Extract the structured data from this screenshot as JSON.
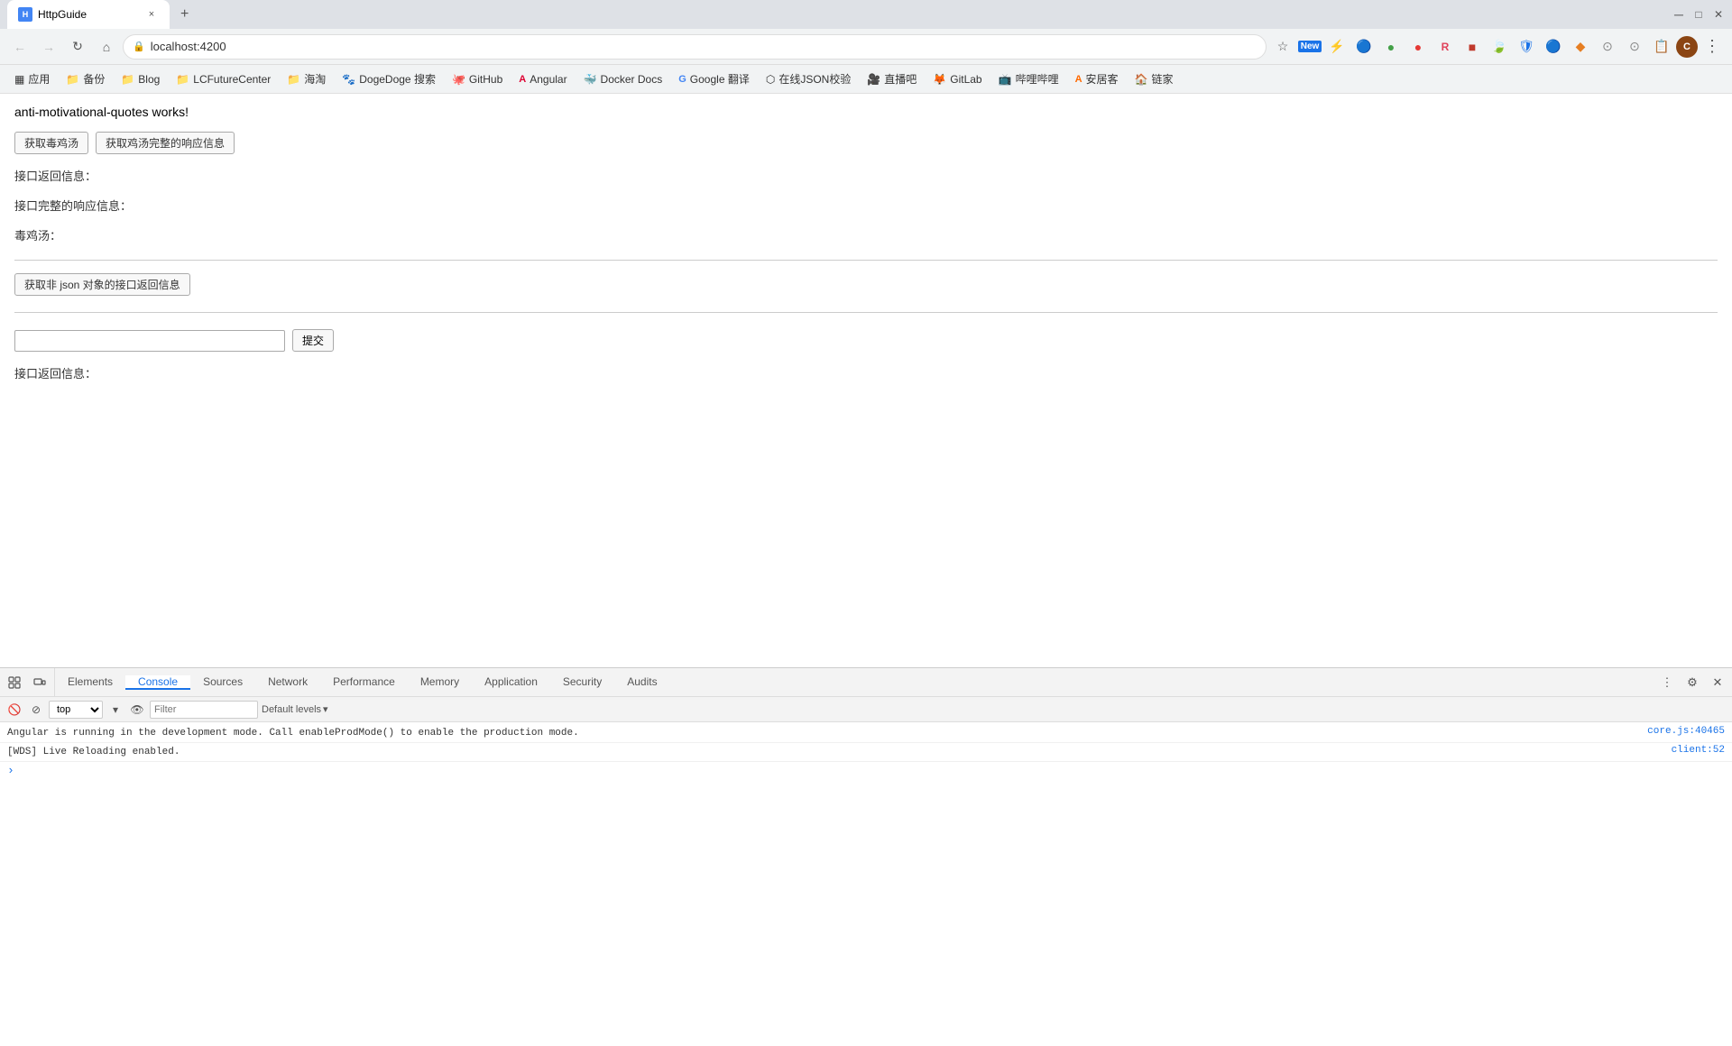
{
  "browser": {
    "title": "HttpGuide",
    "url": "localhost:4200",
    "tab_favicon": "H",
    "tab_close": "×",
    "new_tab": "+"
  },
  "nav": {
    "back": "←",
    "forward": "→",
    "reload": "↻",
    "home": "⌂",
    "lock": "🔒",
    "star": "☆",
    "extensions": "⚡",
    "new_icon": "N",
    "menu": "⋮"
  },
  "bookmarks": [
    {
      "label": "应用",
      "icon": "▦"
    },
    {
      "label": "备份",
      "icon": "📁"
    },
    {
      "label": "Blog",
      "icon": "📁"
    },
    {
      "label": "LCFutureCenter",
      "icon": "📁"
    },
    {
      "label": "海淘",
      "icon": "📁"
    },
    {
      "label": "DogeDoge 搜索",
      "icon": "🐾"
    },
    {
      "label": "GitHub",
      "icon": "🐙"
    },
    {
      "label": "Angular",
      "icon": "A"
    },
    {
      "label": "Docker Docs",
      "icon": "🐳"
    },
    {
      "label": "Google 翻译",
      "icon": "G"
    },
    {
      "label": "在线JSON校验",
      "icon": "⬡"
    },
    {
      "label": "直播吧",
      "icon": "🎥"
    },
    {
      "label": "GitLab",
      "icon": "🦊"
    },
    {
      "label": "哔哩哔哩",
      "icon": "📺"
    },
    {
      "label": "安居客",
      "icon": "A"
    },
    {
      "label": "链家",
      "icon": "🏠"
    }
  ],
  "page": {
    "title": "anti-motivational-quotes works!",
    "btn1": "获取毒鸡汤",
    "btn2": "获取鸡汤完整的响应信息",
    "label1": "接口返回信息：",
    "label2": "接口完整的响应信息：",
    "label3": "毒鸡汤：",
    "btn3": "获取非 json 对象的接口返回信息",
    "input_placeholder": "",
    "submit_btn": "提交",
    "label4": "接口返回信息："
  },
  "devtools": {
    "tabs": [
      {
        "label": "Elements"
      },
      {
        "label": "Console",
        "active": true
      },
      {
        "label": "Sources"
      },
      {
        "label": "Network"
      },
      {
        "label": "Performance"
      },
      {
        "label": "Memory"
      },
      {
        "label": "Application"
      },
      {
        "label": "Security"
      },
      {
        "label": "Audits"
      }
    ],
    "console": {
      "context": "top",
      "filter_placeholder": "Filter",
      "levels": "Default levels ▾",
      "messages": [
        {
          "text": "Angular is running in the development mode. Call enableProdMode() to enable the production mode.",
          "link": "core.js:40465"
        },
        {
          "text": "[WDS] Live Reloading enabled.",
          "link": "client:52"
        }
      ]
    }
  }
}
